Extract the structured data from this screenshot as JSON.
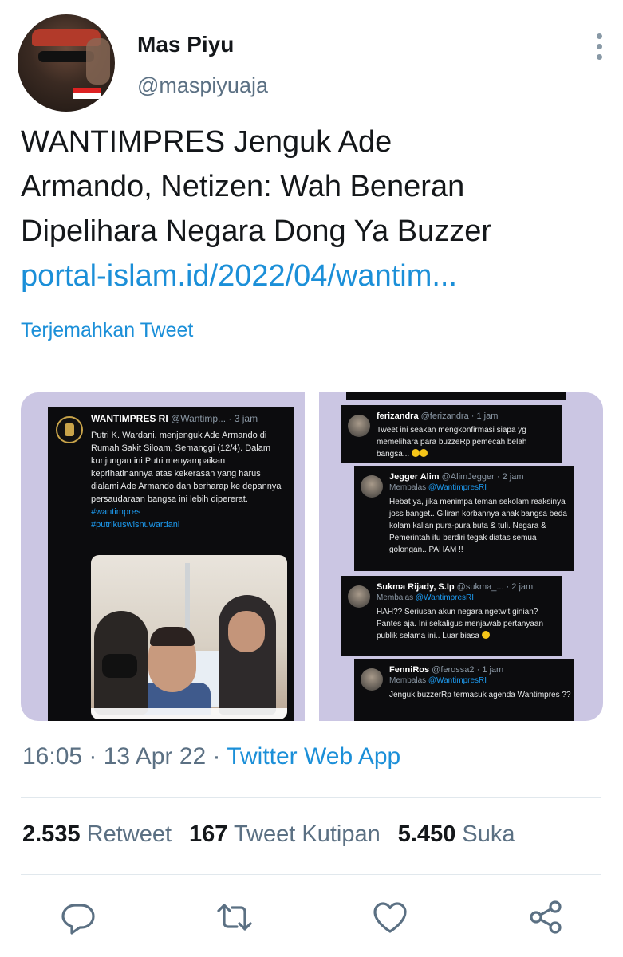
{
  "author": {
    "name": "Mas Piyu",
    "handle": "@maspiyuaja"
  },
  "tweet": {
    "text_lines": [
      "WANTIMPRES Jenguk Ade",
      "Armando, Netizen: Wah Beneran",
      "Dipelihara Negara Dong Ya Buzzer"
    ],
    "link": "portal-islam.id/2022/04/wantim...",
    "translate_label": "Terjemahkan Tweet"
  },
  "media": {
    "left": {
      "username": "WANTIMPRES RI",
      "meta": " @Wantimp... · 3 jam",
      "body": "Putri K. Wardani, menjenguk Ade Armando di Rumah Sakit Siloam, Semanggi (12/4). Dalam kunjungan ini Putri menyampaikan keprihatinannya atas kekerasan yang harus dialami Ade Armando dan berharap ke depannya persaudaraan bangsa ini lebih dipererat.",
      "tags": [
        "#wantimpres",
        "#putrikuswisnuwardani"
      ]
    },
    "right": {
      "replies": [
        {
          "username": "ferizandra",
          "meta": " @ferizandra · 1 jam",
          "replying": "",
          "text": "Tweet ini seakan mengkonfirmasi siapa yg memelihara para buzzeRp pemecah belah bangsa..."
        },
        {
          "username": "Jegger Alim",
          "meta": " @AlimJegger · 2 jam",
          "replying": "Membalas ",
          "replying_to": "@WantimpresRI",
          "text": "Hebat ya, jika menimpa teman sekolam reaksinya joss banget.. Giliran korbannya anak bangsa beda kolam kalian pura-pura buta & tuli. Negara & Pemerintah itu berdiri tegak diatas semua golongan.. PAHAM !!"
        },
        {
          "username": "Sukma Rijady, S.Ip",
          "meta": " @sukma_... · 2 jam",
          "replying": "Membalas ",
          "replying_to": "@WantimpresRI",
          "text": "HAH?? Seriusan akun negara ngetwit ginian? Pantes aja. Ini sekaligus menjawab pertanyaan publik selama ini.. Luar biasa"
        },
        {
          "username": "FenniRos",
          "meta": " @ferossa2 · 1 jam",
          "replying": "Membalas ",
          "replying_to": "@WantimpresRI",
          "text": "Jenguk buzzerRp termasuk agenda Wantimpres ??"
        }
      ]
    }
  },
  "timestamp": {
    "time": "16:05",
    "sep1": " · ",
    "date": "13 Apr 22",
    "sep2": " · ",
    "app": "Twitter Web App"
  },
  "stats": {
    "retweets": "2.535",
    "retweets_label": " Retweet",
    "quotes": "167",
    "quotes_label": " Tweet Kutipan",
    "likes": "5.450",
    "likes_label": " Suka"
  },
  "icons": {
    "reply": "reply-icon",
    "retweet": "retweet-icon",
    "like": "heart-icon",
    "share": "share-icon",
    "more": "more-vertical-icon"
  },
  "colors": {
    "link": "#1b8fd8",
    "secondary_text": "#5b7083",
    "media_background": "#cbc6e3"
  }
}
